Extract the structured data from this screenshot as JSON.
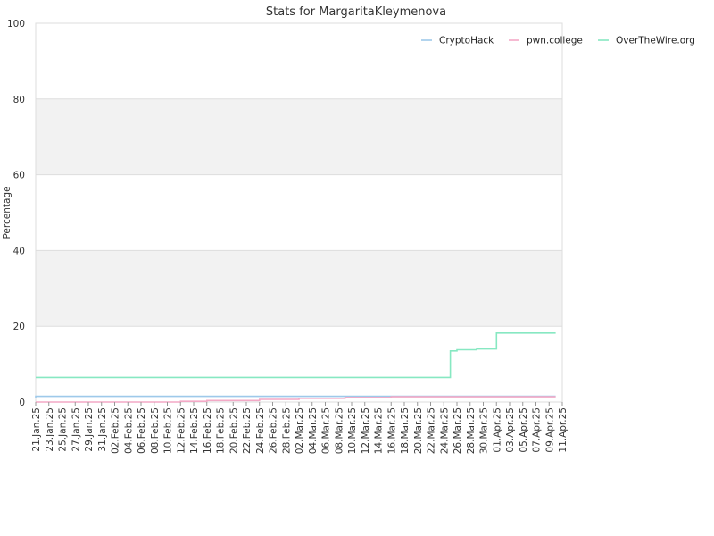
{
  "chart_data": {
    "type": "line",
    "title": "Stats for MargaritaKleymenova",
    "xlabel": "",
    "ylabel": "Percentage",
    "ylim": [
      0,
      100
    ],
    "yticks": [
      "0",
      "20",
      "40",
      "60",
      "80",
      "100"
    ],
    "xlim": [
      "2025-01-21",
      "2025-04-11"
    ],
    "xticks": [
      "21.Jan.25",
      "23.Jan.25",
      "25.Jan.25",
      "27.Jan.25",
      "29.Jan.25",
      "31.Jan.25",
      "02.Feb.25",
      "04.Feb.25",
      "06.Feb.25",
      "08.Feb.25",
      "10.Feb.25",
      "12.Feb.25",
      "14.Feb.25",
      "16.Feb.25",
      "18.Feb.25",
      "20.Feb.25",
      "22.Feb.25",
      "24.Feb.25",
      "26.Feb.25",
      "28.Feb.25",
      "02.Mar.25",
      "04.Mar.25",
      "06.Mar.25",
      "08.Mar.25",
      "10.Mar.25",
      "12.Mar.25",
      "14.Mar.25",
      "16.Mar.25",
      "18.Mar.25",
      "20.Mar.25",
      "22.Mar.25",
      "24.Mar.25",
      "26.Mar.25",
      "28.Mar.25",
      "30.Mar.25",
      "01.Apr.25",
      "03.Apr.25",
      "05.Apr.25",
      "07.Apr.25",
      "09.Apr.25",
      "11.Apr.25"
    ],
    "grid": true,
    "legend_position": "top-right",
    "series": [
      {
        "name": "CryptoHack",
        "color": "#9ec9ea",
        "x": [
          "2025-01-21",
          "2025-01-21",
          "2025-04-10"
        ],
        "y": [
          1.1,
          1.5,
          1.5
        ]
      },
      {
        "name": "pwn.college",
        "color": "#f3a9c6",
        "x": [
          "2025-01-21",
          "2025-02-12",
          "2025-02-16",
          "2025-02-24",
          "2025-03-02",
          "2025-03-09",
          "2025-03-16",
          "2025-04-10"
        ],
        "y": [
          0.0,
          0.2,
          0.4,
          0.7,
          1.0,
          1.2,
          1.4,
          1.4
        ]
      },
      {
        "name": "OverTheWire.org",
        "color": "#87e8c2",
        "x": [
          "2025-01-21",
          "2025-03-25",
          "2025-03-26",
          "2025-03-29",
          "2025-04-01",
          "2025-04-10"
        ],
        "y": [
          6.5,
          13.5,
          13.8,
          14.0,
          18.2,
          18.2
        ]
      }
    ]
  }
}
